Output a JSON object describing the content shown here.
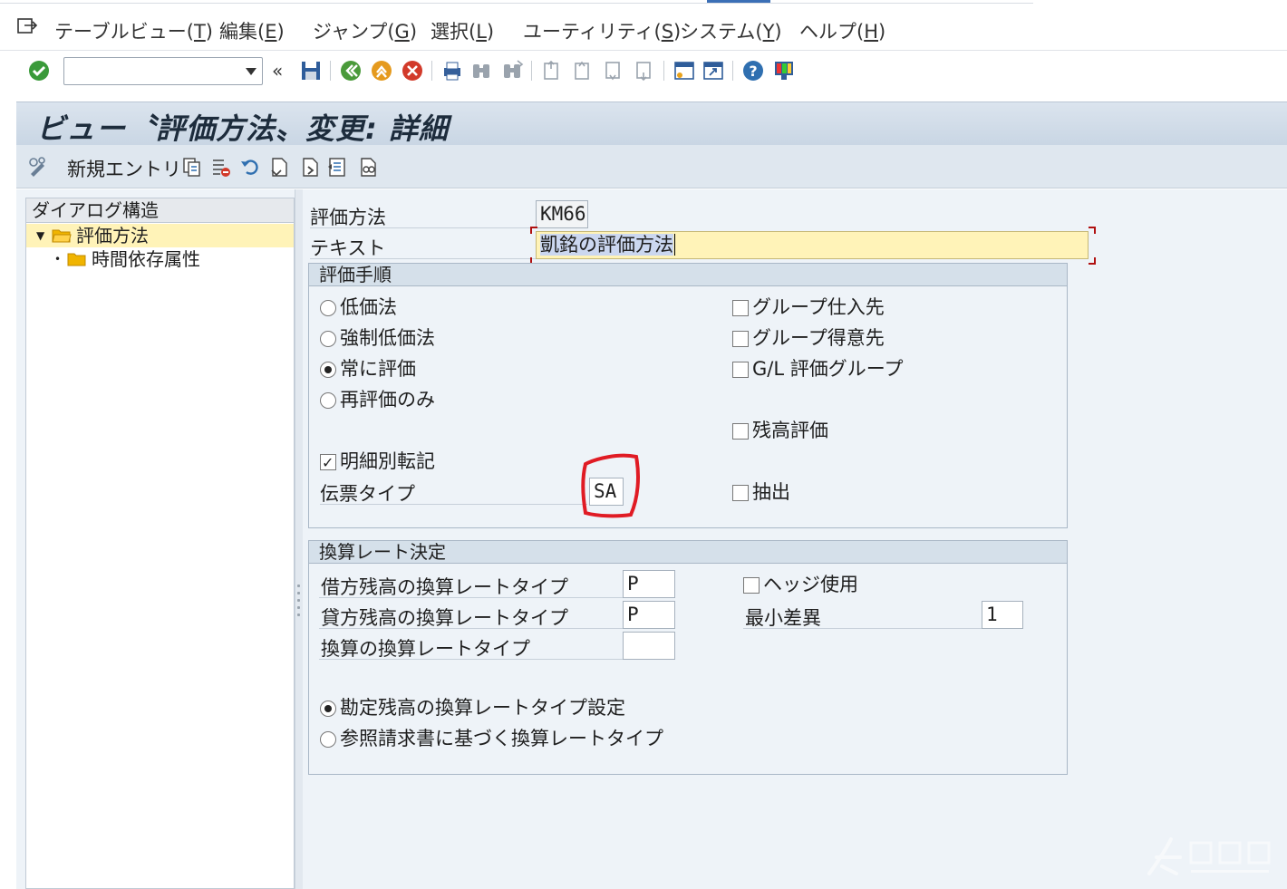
{
  "menu": {
    "items": [
      {
        "label": "テーブルビュー",
        "key": "T"
      },
      {
        "label": "編集",
        "key": "E"
      },
      {
        "label": "ジャンプ",
        "key": "G"
      },
      {
        "label": "選択",
        "key": "L"
      },
      {
        "label": "ユーティリティ",
        "key": "S"
      },
      {
        "label": "システム",
        "key": "Y"
      },
      {
        "label": "ヘルプ",
        "key": "H"
      }
    ]
  },
  "toolbar": {
    "command_value": "",
    "icons": [
      "enter-icon",
      "back-arrow-icon",
      "save-icon",
      "back-icon",
      "exit-icon",
      "cancel-icon",
      "print-icon",
      "find-icon",
      "find-next-icon",
      "first-page-icon",
      "previous-page-icon",
      "next-page-icon",
      "last-page-icon",
      "new-session-icon",
      "shortcut-icon",
      "help-icon",
      "layout-icon"
    ]
  },
  "title": "ビュー〝評価方法〟変更: 詳細",
  "app_toolbar": {
    "new_entry_label": "新規エントリ",
    "icons": [
      "display-change-icon",
      "copy-icon",
      "delete-icon",
      "undo-icon",
      "select-all-icon",
      "next-entry-icon",
      "previous-entry-icon",
      "print-view-icon"
    ]
  },
  "dialog_structure": {
    "header": "ダイアログ構造",
    "items": [
      {
        "label": "評価方法",
        "selected": true,
        "expanded": true
      },
      {
        "label": "時間依存属性",
        "selected": false
      }
    ]
  },
  "header_fields": {
    "method_label": "評価方法",
    "method_value": "KM66",
    "text_label": "テキスト",
    "text_value": "凱銘の評価方法"
  },
  "valuation_procedure": {
    "title": "評価手順",
    "radios": [
      {
        "label": "低価法",
        "checked": false
      },
      {
        "label": "強制低価法",
        "checked": false
      },
      {
        "label": "常に評価",
        "checked": true
      },
      {
        "label": "再評価のみ",
        "checked": false
      }
    ],
    "checks_right": [
      {
        "label": "グループ仕入先",
        "checked": false
      },
      {
        "label": "グループ得意先",
        "checked": false
      },
      {
        "label": "G/L 評価グループ",
        "checked": false
      },
      {
        "label": "残高評価",
        "checked": false
      },
      {
        "label": "抽出",
        "checked": false
      }
    ],
    "line_item_check": {
      "label": "明細別転記",
      "checked": true
    },
    "doc_type_label": "伝票タイプ",
    "doc_type_value": "SA"
  },
  "exchange_rate": {
    "title": "換算レート決定",
    "debit_label": "借方残高の換算レートタイプ",
    "debit_value": "P",
    "credit_label": "貸方残高の換算レートタイプ",
    "credit_value": "P",
    "conv_label": "換算の換算レートタイプ",
    "conv_value": "",
    "hedge": {
      "label": "ヘッジ使用",
      "checked": false
    },
    "min_diff_label": "最小差異",
    "min_diff_value": "1",
    "radios": [
      {
        "label": "勘定残高の換算レートタイプ設定",
        "checked": true
      },
      {
        "label": "参照請求書に基づく換算レートタイプ",
        "checked": false
      }
    ]
  },
  "colors": {
    "highlight": "#fff3b8",
    "annotation": "#e01b24",
    "accent": "#3b6fb6"
  }
}
